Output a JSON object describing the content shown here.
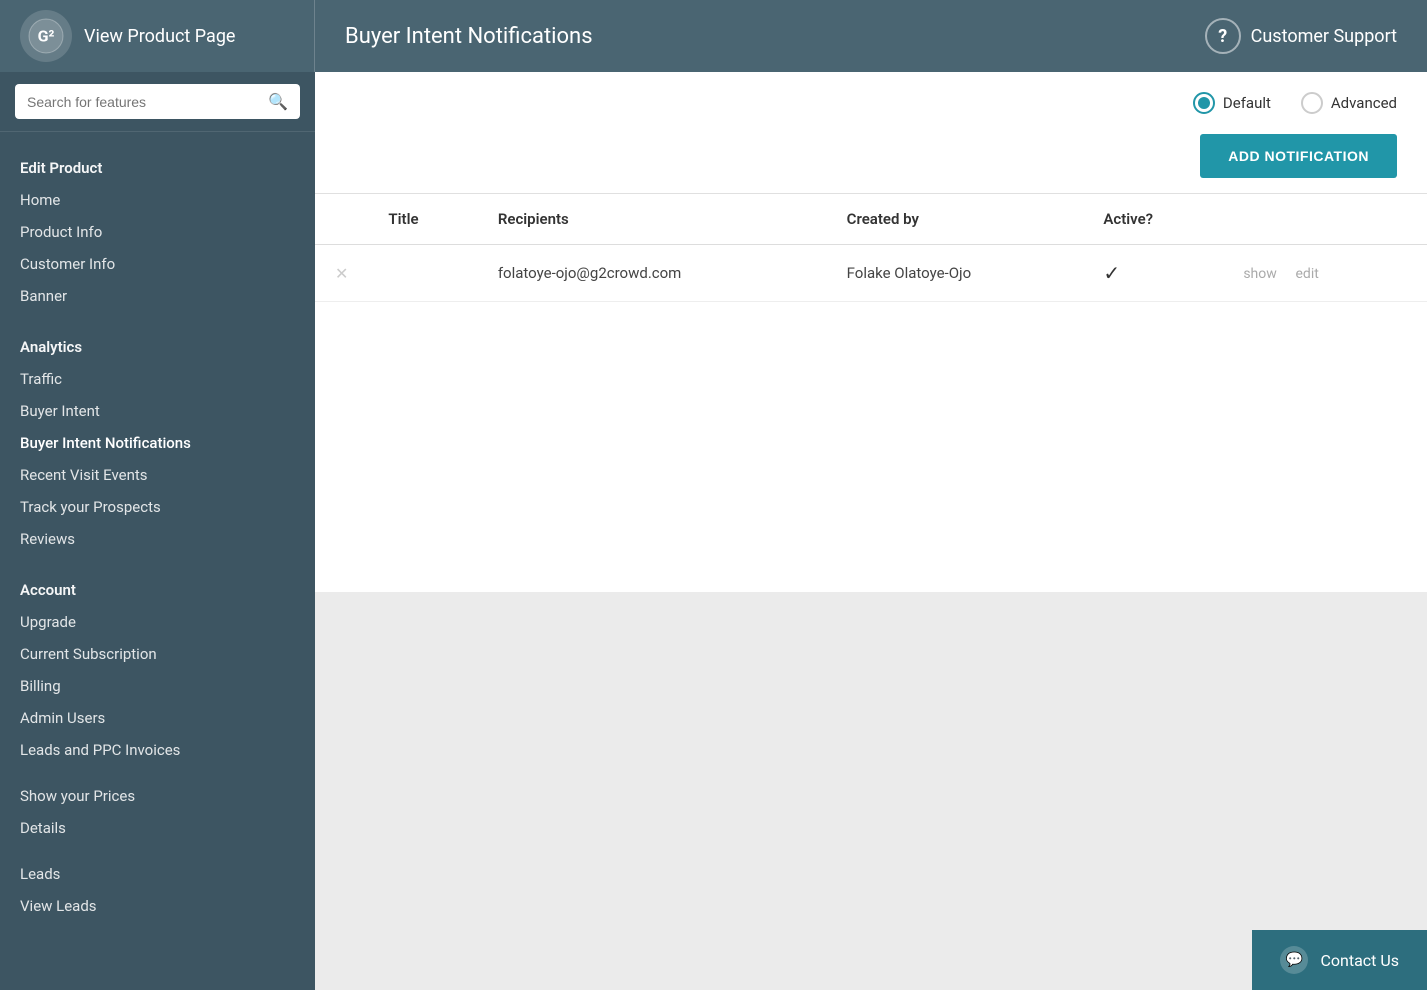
{
  "header": {
    "logo_symbol": "G²",
    "view_product_label": "View Product Page",
    "page_title": "Buyer Intent Notifications",
    "customer_support_label": "Customer Support",
    "help_icon": "?"
  },
  "search": {
    "placeholder": "Search for features"
  },
  "sidebar": {
    "edit_product_section": {
      "header": "Edit Product",
      "items": [
        {
          "label": "Home",
          "id": "home"
        },
        {
          "label": "Product Info",
          "id": "product-info"
        },
        {
          "label": "Customer Info",
          "id": "customer-info"
        },
        {
          "label": "Banner",
          "id": "banner"
        }
      ]
    },
    "analytics_section": {
      "header": "Analytics",
      "items": [
        {
          "label": "Traffic",
          "id": "traffic"
        },
        {
          "label": "Buyer Intent",
          "id": "buyer-intent"
        },
        {
          "label": "Buyer Intent Notifications",
          "id": "buyer-intent-notifications",
          "active": true
        },
        {
          "label": "Recent Visit Events",
          "id": "recent-visit-events"
        },
        {
          "label": "Track your Prospects",
          "id": "track-prospects"
        },
        {
          "label": "Reviews",
          "id": "reviews"
        }
      ]
    },
    "account_section": {
      "header": "Account",
      "items": [
        {
          "label": "Upgrade",
          "id": "upgrade"
        },
        {
          "label": "Current Subscription",
          "id": "current-subscription"
        },
        {
          "label": "Billing",
          "id": "billing"
        },
        {
          "label": "Admin Users",
          "id": "admin-users"
        },
        {
          "label": "Leads and PPC Invoices",
          "id": "leads-ppc-invoices"
        }
      ]
    },
    "prices_section": {
      "items": [
        {
          "label": "Show your Prices",
          "id": "show-prices"
        },
        {
          "label": "Details",
          "id": "details"
        }
      ]
    },
    "leads_section": {
      "items": [
        {
          "label": "Leads",
          "id": "leads"
        },
        {
          "label": "View Leads",
          "id": "view-leads"
        }
      ]
    }
  },
  "content": {
    "radio_default_label": "Default",
    "radio_advanced_label": "Advanced",
    "add_notification_label": "ADD NOTIFICATION",
    "table": {
      "columns": [
        "Title",
        "Recipients",
        "Created by",
        "Active?"
      ],
      "rows": [
        {
          "title": "",
          "recipients": "folatoye-ojo@g2crowd.com",
          "created_by": "Folake Olatoye-Ojo",
          "active": true,
          "show_action": "show",
          "edit_action": "edit"
        }
      ]
    }
  },
  "contact_us": {
    "label": "Contact Us",
    "chat_icon": "💬"
  }
}
